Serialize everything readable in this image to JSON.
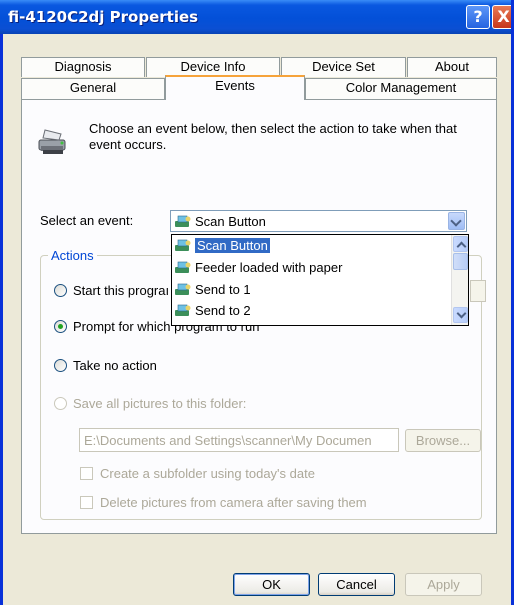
{
  "window": {
    "title": "fi-4120C2dj Properties",
    "help_glyph": "?",
    "close_glyph": "X"
  },
  "tabs_row1": [
    "Diagnosis",
    "Device Info",
    "Device Set",
    "About"
  ],
  "tabs_row2": [
    "General",
    "Events",
    "Color Management"
  ],
  "active_tab": "Events",
  "description": {
    "line1": "Choose an event below, then select the action to take when that",
    "line2": "event occurs.",
    "icon": "scanner-icon"
  },
  "event_select": {
    "label": "Select an event:",
    "value": "Scan Button",
    "options": [
      "Scan Button",
      "Feeder loaded with paper",
      "Send to 1",
      "Send to 2"
    ]
  },
  "actions": {
    "group_label": "Actions",
    "start_program_partial": "Start this prograı",
    "prompt_partial": "Prompt for which",
    "prompt_tail": "program to run",
    "take_no_action": "Take no action",
    "save_pictures": "Save all pictures to this folder:",
    "folder_path": "E:\\Documents and Settings\\scanner\\My Documen",
    "browse": "Browse...",
    "create_subfolder": "Create a subfolder using today's date",
    "delete_pictures": "Delete pictures from camera after saving them",
    "selected": "prompt"
  },
  "buttons": {
    "ok": "OK",
    "cancel": "Cancel",
    "apply": "Apply"
  },
  "colors": {
    "titlebar": "#0350d8",
    "selection": "#316ac5",
    "group_label": "#0046d5"
  }
}
